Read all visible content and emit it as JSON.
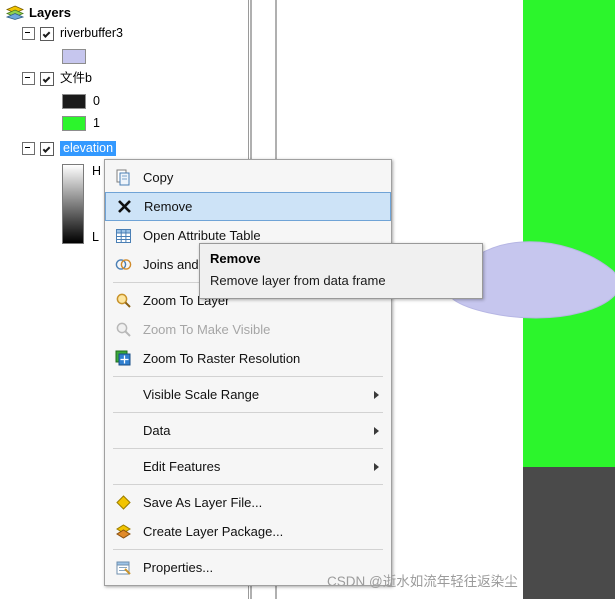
{
  "toc": {
    "title": "Layers",
    "title_icon": "layers-stack-icon",
    "layers": [
      {
        "name": "riverbuffer3",
        "checked": true,
        "expanded": true,
        "selected": false,
        "symbols": [
          {
            "type": "swatch",
            "label": "",
            "color": "#c6c6ee"
          }
        ]
      },
      {
        "name": "文件b",
        "checked": true,
        "expanded": true,
        "selected": false,
        "symbols": [
          {
            "type": "swatch",
            "label": "0",
            "color": "#1a1a1a"
          },
          {
            "type": "swatch",
            "label": "1",
            "color": "#2cf52c"
          }
        ]
      },
      {
        "name": "elevation",
        "checked": true,
        "expanded": true,
        "selected": true,
        "symbols": [
          {
            "type": "ramp",
            "high_label": "H",
            "low_label": "L"
          }
        ]
      }
    ]
  },
  "context_menu": {
    "items": [
      {
        "label": "Copy",
        "icon": "copy-icon",
        "enabled": true,
        "submenu": false,
        "highlighted": false
      },
      {
        "label": "Remove",
        "icon": "remove-x-icon",
        "enabled": true,
        "submenu": false,
        "highlighted": true
      },
      {
        "label": "Open Attribute Table",
        "icon": "table-icon",
        "enabled": true,
        "submenu": false,
        "highlighted": false
      },
      {
        "label": "Joins and Relates",
        "icon": "joins-icon",
        "enabled": true,
        "submenu": true,
        "highlighted": false
      },
      {
        "label": "Zoom To Layer",
        "icon": "zoom-layer-icon",
        "enabled": true,
        "submenu": false,
        "highlighted": false
      },
      {
        "label": "Zoom To Make Visible",
        "icon": "zoom-visible-icon",
        "enabled": false,
        "submenu": false,
        "highlighted": false
      },
      {
        "label": "Zoom To Raster Resolution",
        "icon": "zoom-raster-icon",
        "enabled": true,
        "submenu": false,
        "highlighted": false
      },
      {
        "label": "Visible Scale Range",
        "icon": "none",
        "enabled": true,
        "submenu": true,
        "highlighted": false
      },
      {
        "label": "Data",
        "icon": "none",
        "enabled": true,
        "submenu": true,
        "highlighted": false
      },
      {
        "label": "Edit Features",
        "icon": "none",
        "enabled": true,
        "submenu": true,
        "highlighted": false
      },
      {
        "label": "Save As Layer File...",
        "icon": "layer-file-icon",
        "enabled": true,
        "submenu": false,
        "highlighted": false
      },
      {
        "label": "Create Layer Package...",
        "icon": "layer-package-icon",
        "enabled": true,
        "submenu": false,
        "highlighted": false
      },
      {
        "label": "Properties...",
        "icon": "properties-icon",
        "enabled": true,
        "submenu": false,
        "highlighted": false
      }
    ]
  },
  "tooltip": {
    "title": "Remove",
    "body": "Remove layer from data frame"
  },
  "watermark": {
    "text": "CSDN @逝水如流年轻往返染尘"
  },
  "colors": {
    "highlight_fill": "#cde3f7",
    "selection_blue": "#3399ff",
    "map_green": "#2cf52c",
    "map_dark": "#4a4a4a",
    "buffer_purple": "#c6c6ee",
    "river_gray": "#b0b0b0"
  }
}
